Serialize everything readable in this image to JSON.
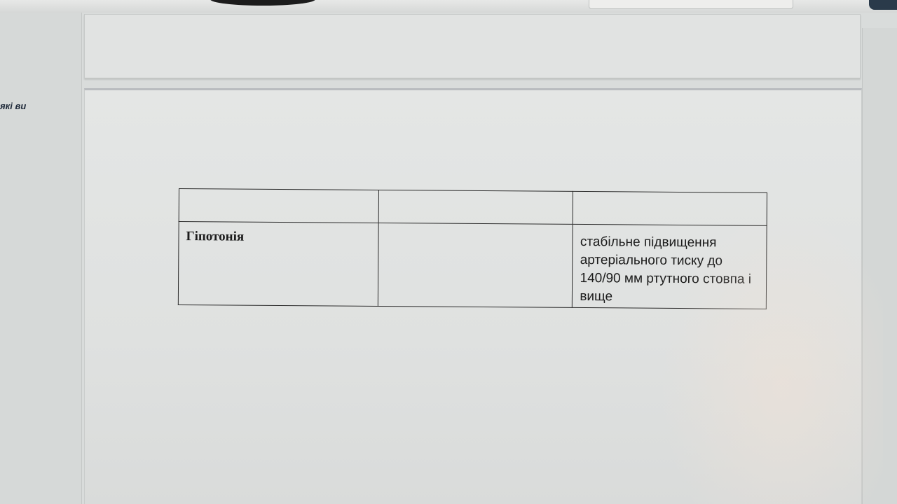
{
  "sidebar": {
    "snippet": "які ви"
  },
  "table": {
    "header_row": [
      "",
      "",
      ""
    ],
    "rows": [
      {
        "term": "Гіпотонія",
        "middle": "",
        "definition": "стабільне підвищення артеріального тиску до 140/90 мм ртутного стовпа і вище"
      }
    ]
  }
}
